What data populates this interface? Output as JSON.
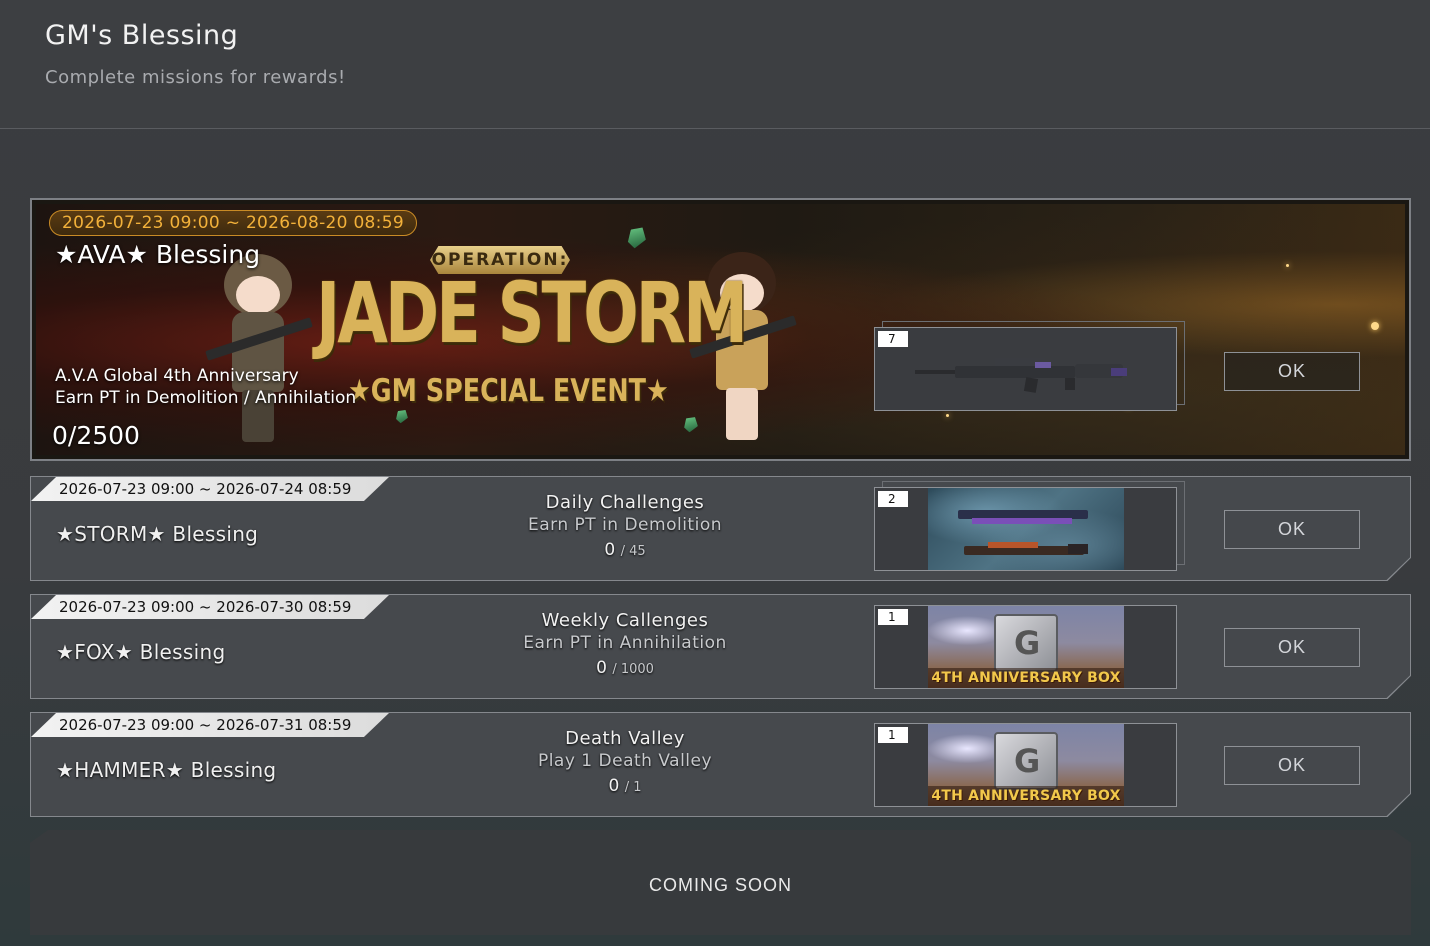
{
  "header": {
    "title": "GM's Blessing",
    "subtitle": "Complete missions for rewards!"
  },
  "featured": {
    "date_range": "2026-07-23 09:00 ~ 2026-08-20 08:59",
    "title": "★AVA★ Blessing",
    "desc_line1": "A.V.A Global 4th Anniversary",
    "desc_line2": "Earn PT in Demolition / Annihilation",
    "progress": "0/2500",
    "banner_op": "OPERATION:",
    "banner_main": "JADE STORM",
    "banner_sub": "★GM SPECIAL EVENT★",
    "reward_qty": "7",
    "reward_icon": "rifle-icon",
    "ok_label": "OK"
  },
  "missions": [
    {
      "date_range": "2026-07-23 09:00 ~ 2026-07-24 08:59",
      "title": "★STORM★ Blessing",
      "name": "Daily Challenges",
      "desc": "Earn PT in Demolition",
      "current": "0",
      "goal": "/ 45",
      "reward_qty": "2",
      "reward_icon": "weapon-skin-icon",
      "ok_label": "OK"
    },
    {
      "date_range": "2026-07-23 09:00 ~ 2026-07-30 08:59",
      "title": "★FOX★ Blessing",
      "name": "Weekly Callenges",
      "desc": "Earn PT in Annihilation",
      "current": "0",
      "goal": "/ 1000",
      "reward_qty": "1",
      "reward_icon": "anniversary-box-icon",
      "reward_label": "4TH ANNIVERSARY BOX",
      "ok_label": "OK"
    },
    {
      "date_range": "2026-07-23 09:00 ~ 2026-07-31 08:59",
      "title": "★HAMMER★ Blessing",
      "name": "Death Valley",
      "desc": "Play 1 Death Valley",
      "current": "0",
      "goal": "/ 1",
      "reward_qty": "1",
      "reward_icon": "anniversary-box-icon",
      "reward_label": "4TH ANNIVERSARY BOX",
      "ok_label": "OK"
    }
  ],
  "coming_soon": "COMING SOON",
  "colors": {
    "date_pill_text": "#f2b13a",
    "banner_gold": "#d9b35a",
    "box_label": "#f2c84b"
  }
}
